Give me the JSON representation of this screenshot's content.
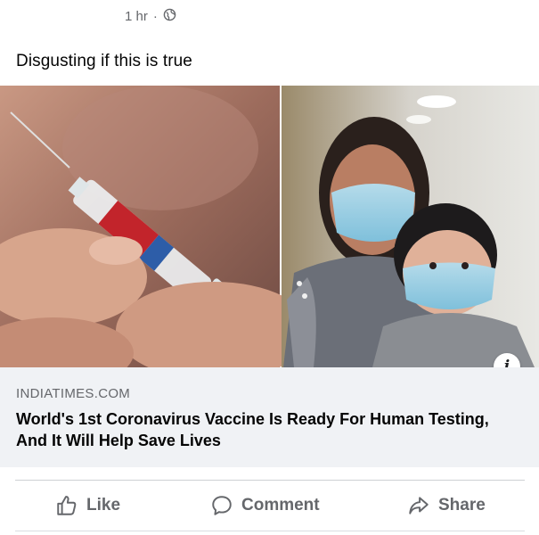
{
  "post": {
    "timestamp": "1 hr",
    "separator": "·",
    "privacy_icon": "globe-icon",
    "text": "Disgusting if this is true"
  },
  "link_preview": {
    "domain": "INDIATIMES.COM",
    "title": "World's 1st Coronavirus Vaccine Is Ready For Human Testing, And It Will Help Save Lives",
    "info_label": "i"
  },
  "actions": {
    "like_label": "Like",
    "like_icon": "thumbs-up-icon",
    "comment_label": "Comment",
    "comment_icon": "comment-bubble-icon",
    "share_label": "Share",
    "share_icon": "share-arrow-icon"
  },
  "colors": {
    "secondary_text": "#65676b",
    "link_box_bg": "#f0f2f5",
    "primary_text": "#050505"
  }
}
